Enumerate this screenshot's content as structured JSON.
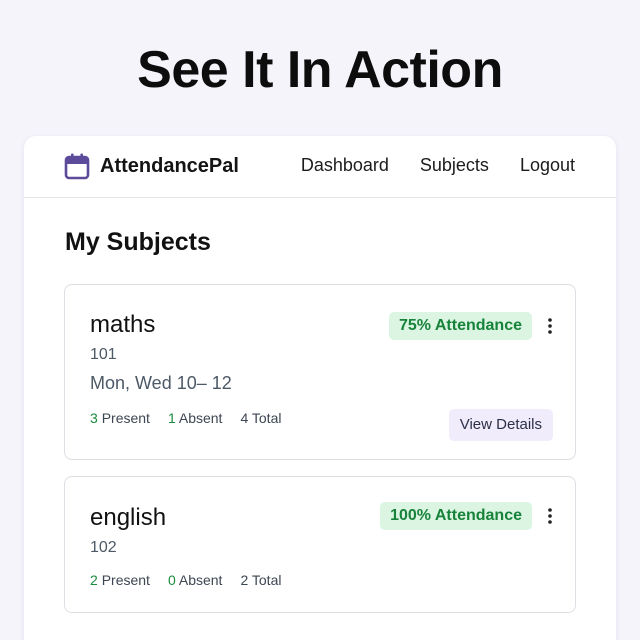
{
  "hero": {
    "title": "See It In Action"
  },
  "navbar": {
    "brand": "AttendancePal",
    "brand_icon": "calendar-icon",
    "links": [
      "Dashboard",
      "Subjects",
      "Logout"
    ]
  },
  "page": {
    "heading": "My Subjects"
  },
  "subjects": [
    {
      "name": "maths",
      "code": "101",
      "schedule": "Mon, Wed 10– 12",
      "attendance": "75% Attendance",
      "present_count": "3",
      "present_label": "Present",
      "absent_count": "1",
      "absent_label": "Absent",
      "total_count": "4",
      "total_label": "Total",
      "action": "View Details"
    },
    {
      "name": "english",
      "code": "102",
      "attendance": "100% Attendance",
      "present_count": "2",
      "present_label": "Present",
      "absent_count": "0",
      "absent_label": "Absent",
      "total_count": "2",
      "total_label": "Total"
    }
  ],
  "colors": {
    "accent": "#5b4b9a",
    "badge_bg": "#dcf5e3",
    "badge_text": "#17833a",
    "button_bg": "#f1ecfb"
  }
}
